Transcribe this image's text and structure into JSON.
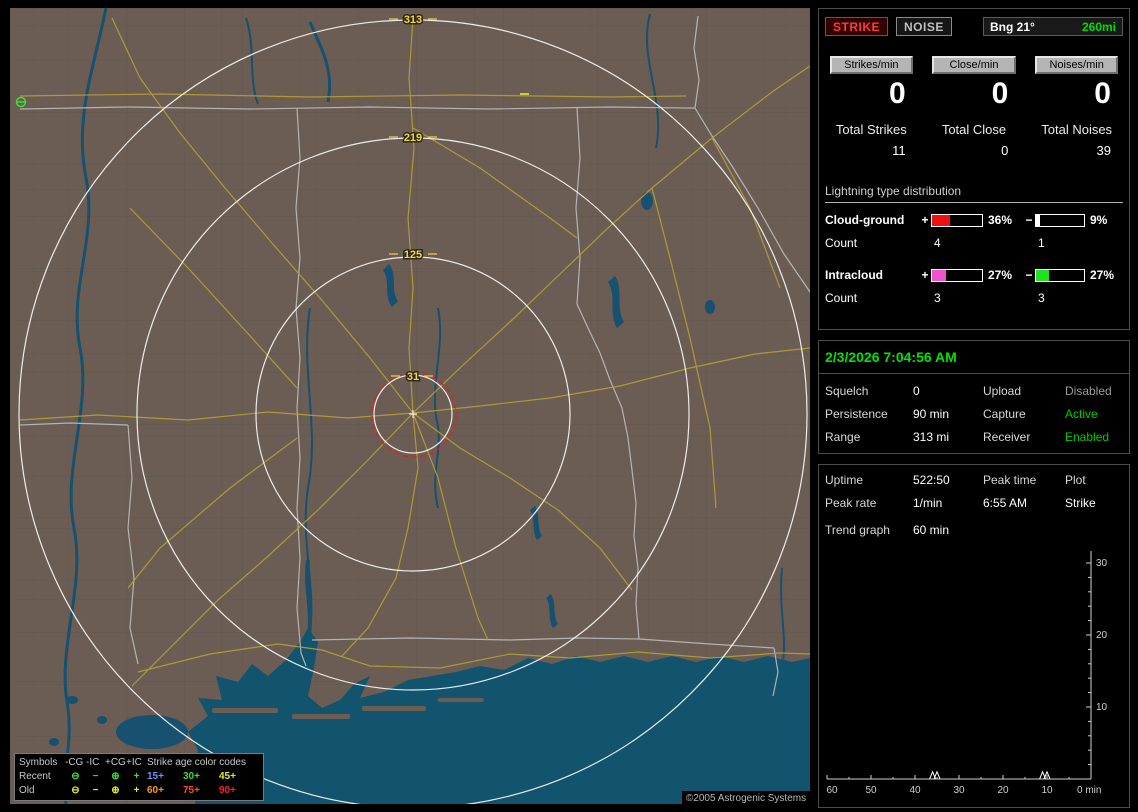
{
  "map": {
    "range_rings": [
      "313",
      "219",
      "125",
      "31"
    ],
    "copyright": "©2005 Astrogenic Systems",
    "colors": {
      "land": "#6b5d54",
      "water": "#12536e",
      "road": "#b2a233",
      "state_border": "#b8b8b8",
      "ring": "#ffffff",
      "ring_label": "#f0d840",
      "alarm_ring": "#e02020"
    },
    "strike_markers": [
      {
        "type": "-CG",
        "age": "recent"
      },
      {
        "type": "-IC",
        "age": "old"
      }
    ],
    "legend": {
      "header": {
        "symbols": "Symbols",
        "cols": [
          "-CG",
          "-IC",
          "+CG",
          "+IC"
        ],
        "age": "Strike age color codes"
      },
      "symbols": [
        "⊖",
        "−",
        "⊕",
        "+"
      ],
      "rows": [
        {
          "label": "Recent",
          "color": "#3ddd3d",
          "ages": [
            {
              "label": "15+",
              "color": "#6f8fff"
            },
            {
              "label": "30+",
              "color": "#3ddd3d"
            },
            {
              "label": "45+",
              "color": "#e6e635"
            }
          ]
        },
        {
          "label": "Old",
          "color": "#e6e635",
          "ages": [
            {
              "label": "60+",
              "color": "#ff9a20"
            },
            {
              "label": "75+",
              "color": "#ff5020"
            },
            {
              "label": "90+",
              "color": "#ff2020"
            }
          ]
        }
      ]
    }
  },
  "panel": {
    "strike_btn": "STRIKE",
    "noise_btn": "NOISE",
    "bearing": "Bng 21°",
    "bearing_range": "260mi",
    "counters": [
      {
        "label": "Strikes/min",
        "value": "0",
        "total_label": "Total Strikes",
        "total": "11"
      },
      {
        "label": "Close/min",
        "value": "0",
        "total_label": "Total Close",
        "total": "0"
      },
      {
        "label": "Noises/min",
        "value": "0",
        "total_label": "Total Noises",
        "total": "39"
      }
    ],
    "distribution": {
      "title": "Lightning type distribution",
      "plus_sign": "+",
      "minus_sign": "−",
      "count_label": "Count",
      "rows": [
        {
          "label": "Cloud-ground",
          "plus_pct": "36%",
          "plus_fill": 36,
          "plus_color": "#ee1111",
          "minus_pct": "9%",
          "minus_fill": 9,
          "minus_color": "#ffffff",
          "plus_count": "4",
          "minus_count": "1"
        },
        {
          "label": "Intracloud",
          "plus_pct": "27%",
          "plus_fill": 27,
          "plus_color": "#ee55cc",
          "minus_pct": "27%",
          "minus_fill": 27,
          "minus_color": "#22e022",
          "plus_count": "3",
          "minus_count": "3"
        }
      ]
    },
    "datetime": "2/3/2026 7:04:56 AM",
    "settings": [
      {
        "label": "Squelch",
        "value": "0",
        "label2": "Upload",
        "value2": "Disabled",
        "value2_color": "#9a9a9a"
      },
      {
        "label": "Persistence",
        "value": "90 min",
        "label2": "Capture",
        "value2": "Active",
        "value2_color": "#00cc00"
      },
      {
        "label": "Range",
        "value": "313 mi",
        "label2": "Receiver",
        "value2": "Enabled",
        "value2_color": "#00cc00"
      }
    ],
    "status": {
      "uptime_label": "Uptime",
      "uptime": "522:50",
      "peak_time_label": "Peak time",
      "plot_label": "Plot",
      "peak_rate_label": "Peak rate",
      "peak_rate": "1/min",
      "peak_time": "6:55 AM",
      "plot_value": "Strike",
      "trend_label": "Trend graph",
      "trend_value": "60 min"
    },
    "trend_chart": {
      "type": "line",
      "x_ticks": [
        "60",
        "50",
        "40",
        "30",
        "20",
        "10"
      ],
      "x_end_label": "0 min",
      "y_ticks": [
        "10",
        "20",
        "30"
      ],
      "x_range_min": [
        60,
        0
      ],
      "y_range": [
        0,
        32
      ],
      "spikes": [
        {
          "min": 36,
          "value": 1
        },
        {
          "min": 35,
          "value": 1
        },
        {
          "min": 11,
          "value": 1
        },
        {
          "min": 10,
          "value": 1
        }
      ]
    }
  }
}
